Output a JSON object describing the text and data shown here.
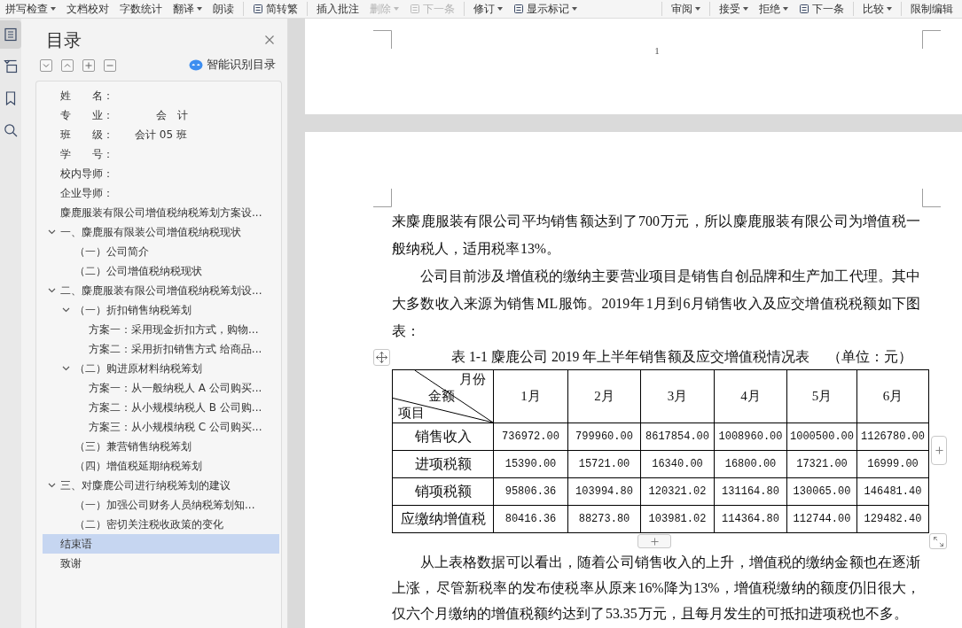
{
  "toolbar": {
    "groups": [
      {
        "items": [
          {
            "label": "拼写检查",
            "dropdown": true,
            "disabled": false,
            "has_icon": false
          },
          {
            "label": "文档校对",
            "dropdown": false,
            "disabled": false,
            "has_icon": false
          },
          {
            "label": "字数统计",
            "dropdown": false,
            "disabled": false,
            "has_icon": false
          },
          {
            "label": "翻译",
            "dropdown": true,
            "disabled": false,
            "has_icon": false
          },
          {
            "label": "朗读",
            "dropdown": false,
            "disabled": false,
            "has_icon": false
          }
        ]
      },
      {
        "items": [
          {
            "label": "简转繁",
            "dropdown": false,
            "disabled": false,
            "has_icon": true
          }
        ]
      },
      {
        "items": [
          {
            "label": "插入批注",
            "dropdown": false,
            "disabled": false,
            "has_icon": false
          },
          {
            "label": "删除",
            "dropdown": true,
            "disabled": true,
            "has_icon": false
          },
          {
            "label": "下一条",
            "dropdown": false,
            "disabled": true,
            "has_icon": true
          }
        ]
      },
      {
        "items": [
          {
            "label": "修订",
            "dropdown": true,
            "disabled": false,
            "has_icon": false
          },
          {
            "label": "显示标记",
            "dropdown": true,
            "disabled": false,
            "has_icon": true
          }
        ]
      },
      {
        "items": [
          {
            "label": "审阅",
            "dropdown": true,
            "disabled": false,
            "has_icon": false
          }
        ]
      },
      {
        "items": [
          {
            "label": "接受",
            "dropdown": true,
            "disabled": false,
            "has_icon": false
          },
          {
            "label": "拒绝",
            "dropdown": true,
            "disabled": false,
            "has_icon": false
          },
          {
            "label": "下一条",
            "dropdown": false,
            "disabled": false,
            "has_icon": true
          }
        ]
      },
      {
        "items": [
          {
            "label": "比较",
            "dropdown": true,
            "disabled": false,
            "has_icon": false
          }
        ]
      },
      {
        "items": [
          {
            "label": "限制编辑",
            "dropdown": false,
            "disabled": false,
            "has_icon": false
          }
        ]
      }
    ]
  },
  "side_tabs": [
    {
      "kind": "contents",
      "selected": true
    },
    {
      "kind": "navigation",
      "selected": false
    },
    {
      "kind": "bookmarks",
      "selected": false
    },
    {
      "kind": "search",
      "selected": false
    }
  ],
  "toc_panel": {
    "title": "目录",
    "smart_button": "智能识别目录",
    "items": [
      {
        "label": "姓　　名：",
        "selected": false
      },
      {
        "label": "专　　业：　　　　会　计",
        "selected": false
      },
      {
        "label": "班　　级：　　会计 05 班",
        "selected": false
      },
      {
        "label": "学　　号：",
        "selected": false
      },
      {
        "label": "校内导师：",
        "selected": false
      },
      {
        "label": "企业导师：",
        "selected": false
      },
      {
        "label": "麋鹿服装有限公司增值税纳税筹划方案设...",
        "selected": false
      },
      {
        "label": "一、麋鹿服有限装公司增值税纳税现状",
        "selected": false,
        "expanded": true,
        "children": [
          {
            "label": "（一）公司简介",
            "selected": false
          },
          {
            "label": "（二）公司增值税纳税现状",
            "selected": false
          }
        ]
      },
      {
        "label": "二、麋鹿服装有限公司增值税纳税筹划设...",
        "selected": false,
        "expanded": true,
        "children": [
          {
            "label": "（一）折扣销售纳税筹划",
            "selected": false,
            "expanded": true,
            "children": [
              {
                "label": "方案一：采用现金折扣方式，购物...",
                "selected": false
              },
              {
                "label": "方案二：采用折扣销售方式 给商品...",
                "selected": false
              }
            ]
          },
          {
            "label": "（二）购进原材料纳税筹划",
            "selected": false,
            "expanded": true,
            "children": [
              {
                "label": "方案一：从一般纳税人 A 公司购买...",
                "selected": false
              },
              {
                "label": "方案二：从小规模纳税人 B 公司购...",
                "selected": false
              },
              {
                "label": "方案三：从小规模纳税 C 公司购买...",
                "selected": false
              }
            ]
          },
          {
            "label": "（三）兼营销售纳税筹划",
            "selected": false
          },
          {
            "label": "（四）增值税延期纳税筹划",
            "selected": false
          }
        ]
      },
      {
        "label": "三、对麋鹿公司进行纳税筹划的建议",
        "selected": false,
        "expanded": true,
        "children": [
          {
            "label": "（一）加强公司财务人员纳税筹划知...",
            "selected": false
          },
          {
            "label": "（二）密切关注税收政策的变化",
            "selected": false
          }
        ]
      },
      {
        "label": "结束语",
        "selected": true
      },
      {
        "label": "致谢",
        "selected": false
      }
    ]
  },
  "document": {
    "page_number": "1",
    "paragraphs_before": [
      {
        "text": "来麋鹿服装有限公司平均销售额达到了 700 万元，所以麋鹿服装有限公司为增值税一般纳税人，适用税率 13%。",
        "indent": false
      },
      {
        "text": "公司目前涉及增值税的缴纳主要营业项目是销售自创品牌和生产加工代理。其中大多数收入来源为销售 ML 服饰。2019 年 1月到 6月销售收入及应交增值税税额如下图表：",
        "indent": true
      }
    ],
    "table": {
      "caption": "表 1-1 麋鹿公司 2019 年上半年销售额及应交增值税情况表",
      "unit": "（单位：元）",
      "corner_labels": [
        "月份",
        "金额",
        "项目"
      ],
      "columns": [
        "1月",
        "2月",
        "3月",
        "4月",
        "5月",
        "6月"
      ],
      "rows": [
        {
          "label": "销售收入",
          "cells": [
            "736972.00",
            "799960.00",
            "8617854.00",
            "1008960.00",
            "1000500.00",
            "1126780.00"
          ]
        },
        {
          "label": "进项税额",
          "cells": [
            "15390.00",
            "15721.00",
            "16340.00",
            "16800.00",
            "17321.00",
            "16999.00"
          ]
        },
        {
          "label": "销项税额",
          "cells": [
            "95806.36",
            "103994.80",
            "120321.02",
            "131164.80",
            "130065.00",
            "146481.40"
          ]
        },
        {
          "label": "应缴纳增值税",
          "cells": [
            "80416.36",
            "88273.80",
            "103981.02",
            "114364.80",
            "112744.00",
            "129482.40"
          ]
        }
      ]
    },
    "paragraphs_after": [
      {
        "text": "从上表格数据可以看出，随着公司销售收入的上升，增值税的缴纳金额也在逐渐上涨， 尽管新税率的发布使税率从原来 16%降为 13%，增值税缴纳的额度仍旧很大，仅六个月缴纳的增值税额约达到了 53.35 万元，且每月发生的可抵扣进项税也不多。",
        "indent": true
      }
    ]
  }
}
